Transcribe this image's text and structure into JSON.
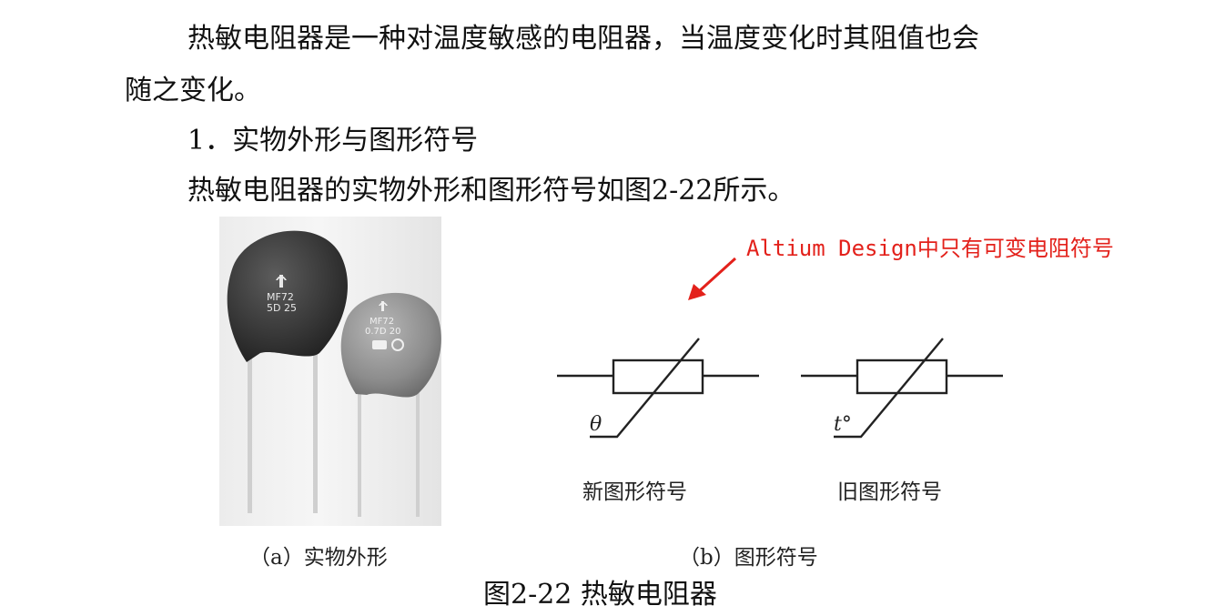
{
  "paragraph1": {
    "line1": "热敏电阻器是一种对温度敏感的电阻器，当温度变化时其阻值也会",
    "line2": "随之变化。"
  },
  "section_heading": "1．实物外形与图形符号",
  "paragraph2": "热敏电阻器的实物外形和图形符号如图2-22所示。",
  "photo": {
    "large_marking": [
      "MF72",
      "5D 25"
    ],
    "small_marking": [
      "MF72",
      "0.7D 20"
    ]
  },
  "symbols": {
    "new_label": "θ",
    "old_label": "t°",
    "new_caption": "新图形符号",
    "old_caption": "旧图形符号"
  },
  "captions": {
    "a": "（a）实物外形",
    "b": "（b）图形符号"
  },
  "figure_title": "图2-22 热敏电阻器",
  "annotation": {
    "text": "Altium Design中只有可变电阻符号",
    "color": "#e3211b"
  }
}
